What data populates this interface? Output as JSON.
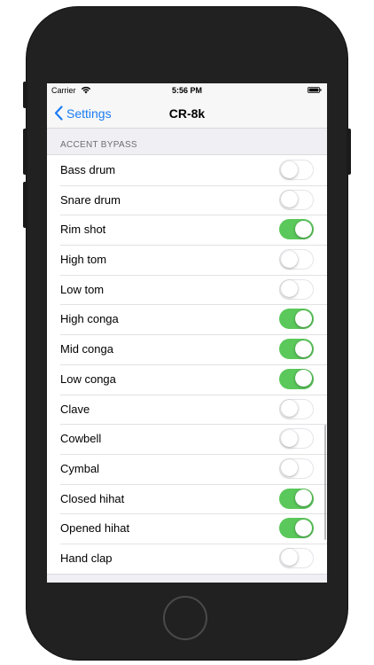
{
  "status_bar": {
    "carrier": "Carrier",
    "time": "5:56 PM",
    "icons": [
      "wifi-icon",
      "battery-icon"
    ]
  },
  "nav": {
    "back_label": "Settings",
    "title": "CR-8k"
  },
  "section": {
    "header": "ACCENT BYPASS"
  },
  "colors": {
    "accent": "#1a7cf5",
    "toggle_on": "#5ac85a"
  },
  "rows": [
    {
      "label": "Bass drum",
      "on": false
    },
    {
      "label": "Snare drum",
      "on": false
    },
    {
      "label": "Rim shot",
      "on": true
    },
    {
      "label": "High tom",
      "on": false
    },
    {
      "label": "Low tom",
      "on": false
    },
    {
      "label": "High conga",
      "on": true
    },
    {
      "label": "Mid conga",
      "on": true
    },
    {
      "label": "Low conga",
      "on": true
    },
    {
      "label": "Clave",
      "on": false
    },
    {
      "label": "Cowbell",
      "on": false
    },
    {
      "label": "Cymbal",
      "on": false
    },
    {
      "label": "Closed hihat",
      "on": true
    },
    {
      "label": "Opened hihat",
      "on": true
    },
    {
      "label": "Hand clap",
      "on": false
    }
  ]
}
